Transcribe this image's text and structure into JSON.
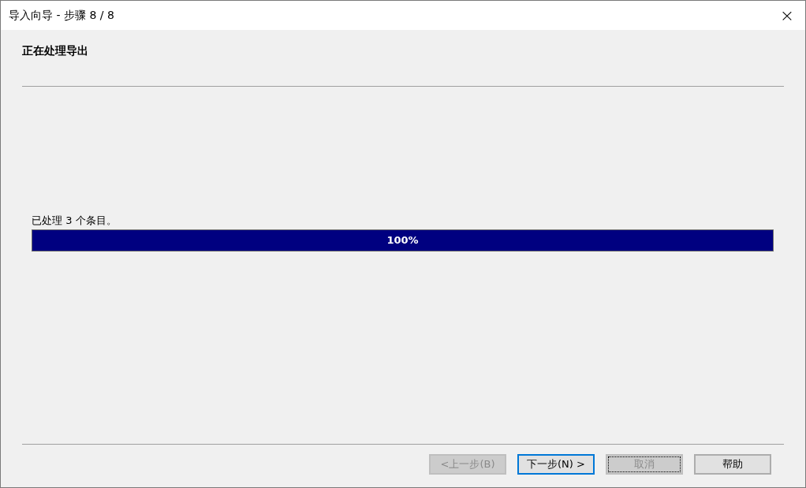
{
  "window": {
    "title": "导入向导 - 步骤 8 / 8",
    "close": "×"
  },
  "heading": "正在处理导出",
  "progress": {
    "label": "已处理 3 个条目。",
    "level": 1,
    "reading": "100%"
  },
  "buttons": [
    {
      "label": "<上一步(B)",
      "disabled": true,
      "default": false,
      "focused": false
    },
    {
      "label": "下一步(N) >",
      "disabled": false,
      "default": true,
      "focused": false
    },
    {
      "label": "取消",
      "disabled": true,
      "default": false,
      "focused": true
    },
    {
      "label": "帮助",
      "disabled": false,
      "default": false,
      "focused": false
    }
  ]
}
